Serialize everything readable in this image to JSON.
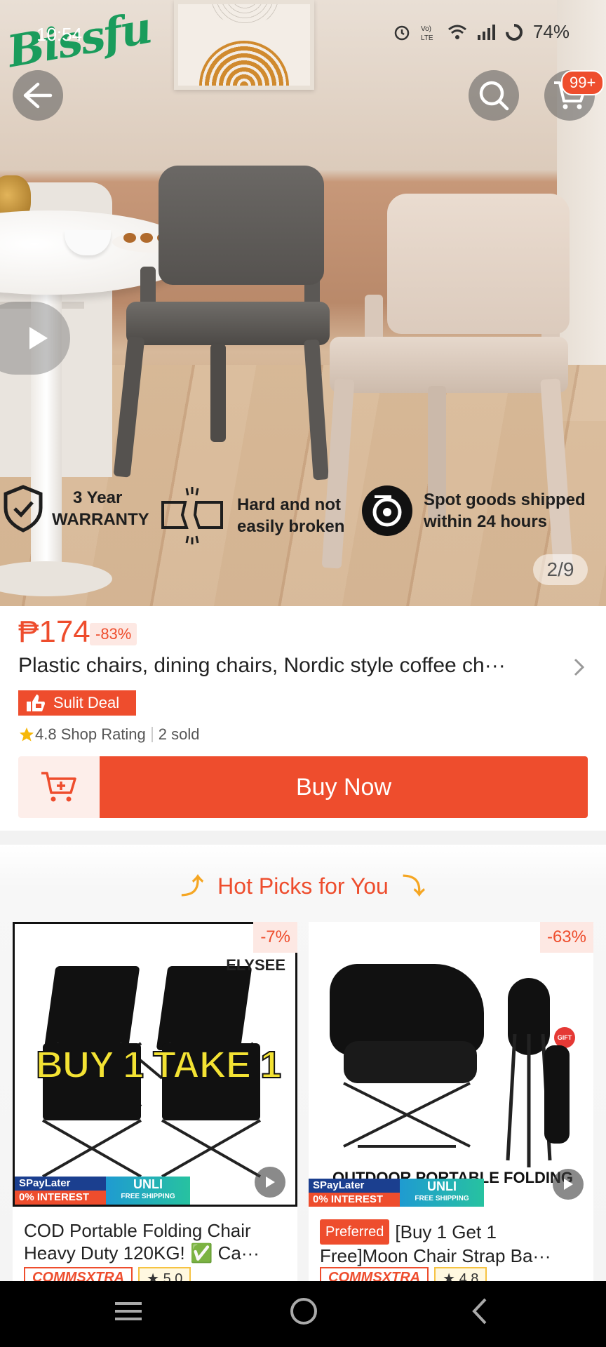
{
  "status_bar": {
    "time": "10:54",
    "battery": "74%"
  },
  "brand": "Bissfu",
  "header": {
    "cart_badge": "99+"
  },
  "gallery": {
    "counter": "2/9",
    "features": [
      {
        "line1": "3 Year",
        "line2": "WARRANTY",
        "icon": "shield-check-icon"
      },
      {
        "line1": "Hard and not",
        "line2": "easily broken",
        "icon": "broken-board-icon"
      },
      {
        "line1": "Spot goods shipped",
        "line2": "within 24 hours",
        "icon": "shipping-disc-icon"
      }
    ]
  },
  "product": {
    "price": "₱174",
    "discount": "-83%",
    "title": "Plastic chairs, dining chairs, Nordic style coffee ch···",
    "deal_label": "Sulit Deal",
    "rating_text": "4.8 Shop Rating",
    "sold_text": "2 sold",
    "buy_label": "Buy Now"
  },
  "hot_picks": {
    "heading": "Hot Picks for You",
    "items": [
      {
        "discount": "-7%",
        "title_line1": "COD Portable Folding Chair",
        "title_line2": "Heavy Duty 120KG! ✅ Ca···",
        "image_text": "BUY 1 TAKE 1",
        "image_brand": "ELYSEE",
        "tag": "COMMSXTRA",
        "rating": "5.0",
        "promo_a1": "SPayLater",
        "promo_a2": "0% INTEREST",
        "promo_b1": "UNLI",
        "promo_b2": "FREE SHIPPING"
      },
      {
        "discount": "-63%",
        "preferred": "Preferred",
        "title_line1": "[Buy 1 Get 1",
        "title_line2": "Free]Moon Chair Strap Ba···",
        "image_text": "OUTDOOR PORTABLE FOLDING CHAIR",
        "gift": "GIFT",
        "tag": "COMMSXTRA",
        "rating": "4.8",
        "promo_a1": "SPayLater",
        "promo_a2": "0% INTEREST",
        "promo_b1": "UNLI",
        "promo_b2": "FREE SHIPPING"
      }
    ]
  },
  "colors": {
    "accent": "#ee4d2d",
    "accent_soft": "#fde8e3",
    "brand_green": "#1a9c5c"
  }
}
